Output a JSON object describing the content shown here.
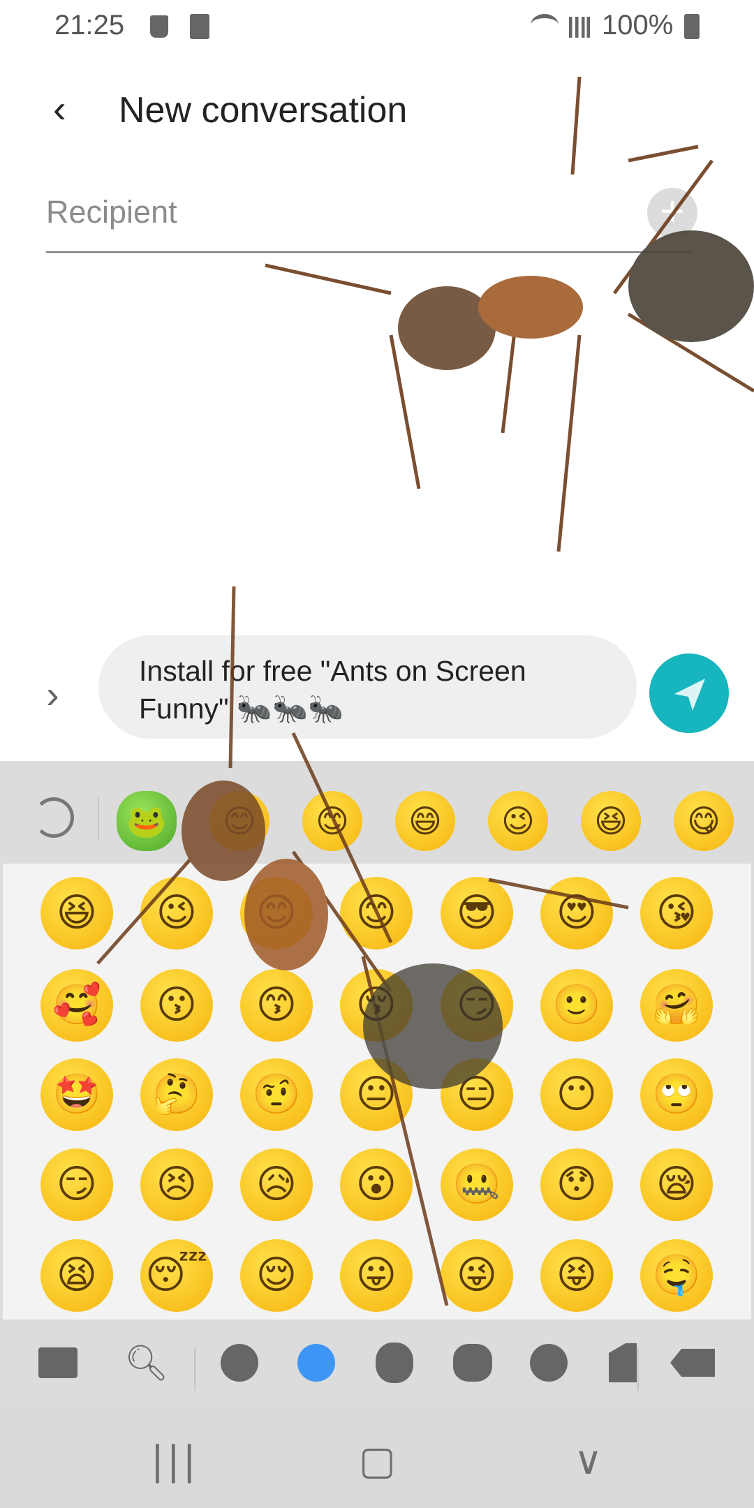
{
  "status_bar": {
    "time": "21:25",
    "battery": "100%",
    "icons": [
      "paint-brush-icon",
      "clock-app-icon",
      "wifi-icon",
      "signal-icon",
      "battery-icon"
    ]
  },
  "header": {
    "title": "New conversation",
    "back_icon": "back-arrow-icon"
  },
  "recipient": {
    "placeholder": "Recipient",
    "add_icon": "plus-icon"
  },
  "message": {
    "text": "Install for free \"Ants on Screen Funny\" 🐜🐜🐜",
    "send_color": "#17b5bd"
  },
  "keyboard": {
    "recent": [
      "🐸",
      "😊",
      "😊",
      "😄",
      "😉",
      "😆",
      "😋"
    ],
    "grid": [
      [
        "😆",
        "😉",
        "😊",
        "😊",
        "😎",
        "😍",
        "😘"
      ],
      [
        "🥰",
        "😗",
        "😙",
        "😚",
        "😏",
        "🙂",
        "🤗"
      ],
      [
        "🤩",
        "🤔",
        "🤨",
        "😐",
        "😑",
        "😶",
        "🙄"
      ],
      [
        "😏",
        "😣",
        "😥",
        "😮",
        "🤐",
        "😯",
        "😪"
      ],
      [
        "😫",
        "😴",
        "😌",
        "😛",
        "😜",
        "😝",
        "🤤"
      ]
    ],
    "toolbar": [
      "keyboard-icon",
      "search-icon",
      "recent-icon",
      "smileys-icon",
      "animals-icon",
      "food-icon",
      "activities-icon",
      "places-icon",
      "backspace-icon"
    ],
    "active_category_color": "#3d96f5"
  },
  "nav": {
    "recents": "|||",
    "home": "▢",
    "back": "∨"
  }
}
